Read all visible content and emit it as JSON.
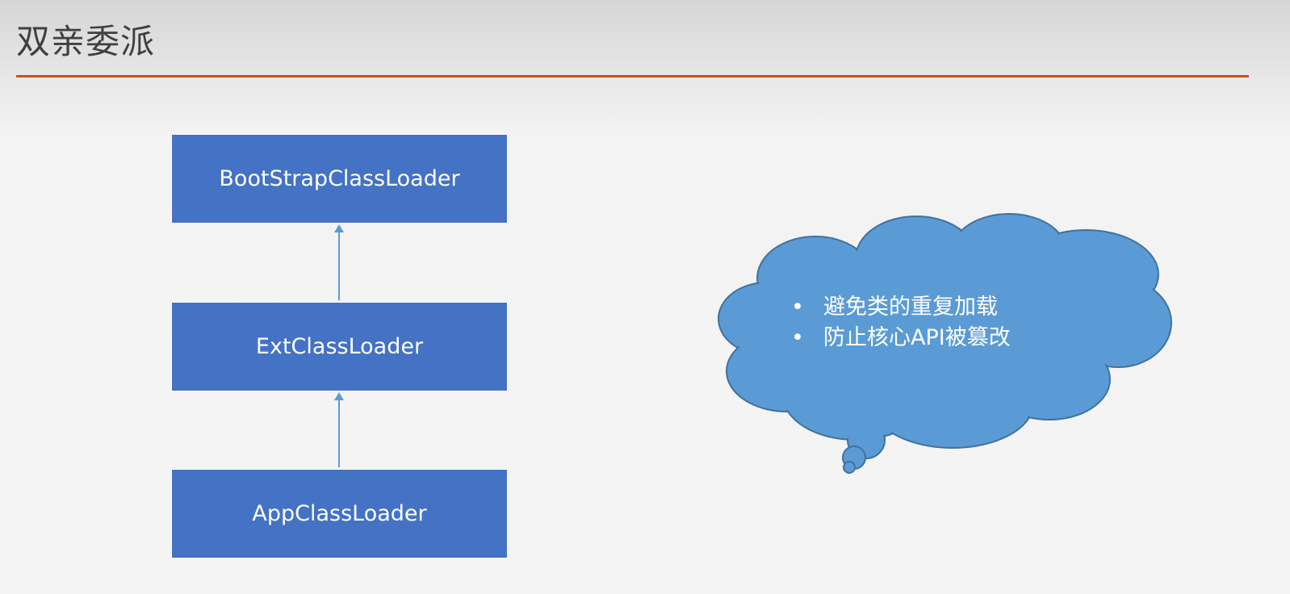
{
  "slide": {
    "title": "双亲委派",
    "accent_color": "#c9501f",
    "box_color": "#4472c4",
    "cloud_color": "#5b9bd5"
  },
  "diagram": {
    "nodes": [
      {
        "label": "BootStrapClassLoader"
      },
      {
        "label": "ExtClassLoader"
      },
      {
        "label": "AppClassLoader"
      }
    ],
    "edges": [
      {
        "from": "ExtClassLoader",
        "to": "BootStrapClassLoader"
      },
      {
        "from": "AppClassLoader",
        "to": "ExtClassLoader"
      }
    ]
  },
  "callout": {
    "shape": "thought-cloud",
    "bullets": [
      "避免类的重复加载",
      "防止核心API被篡改"
    ]
  }
}
